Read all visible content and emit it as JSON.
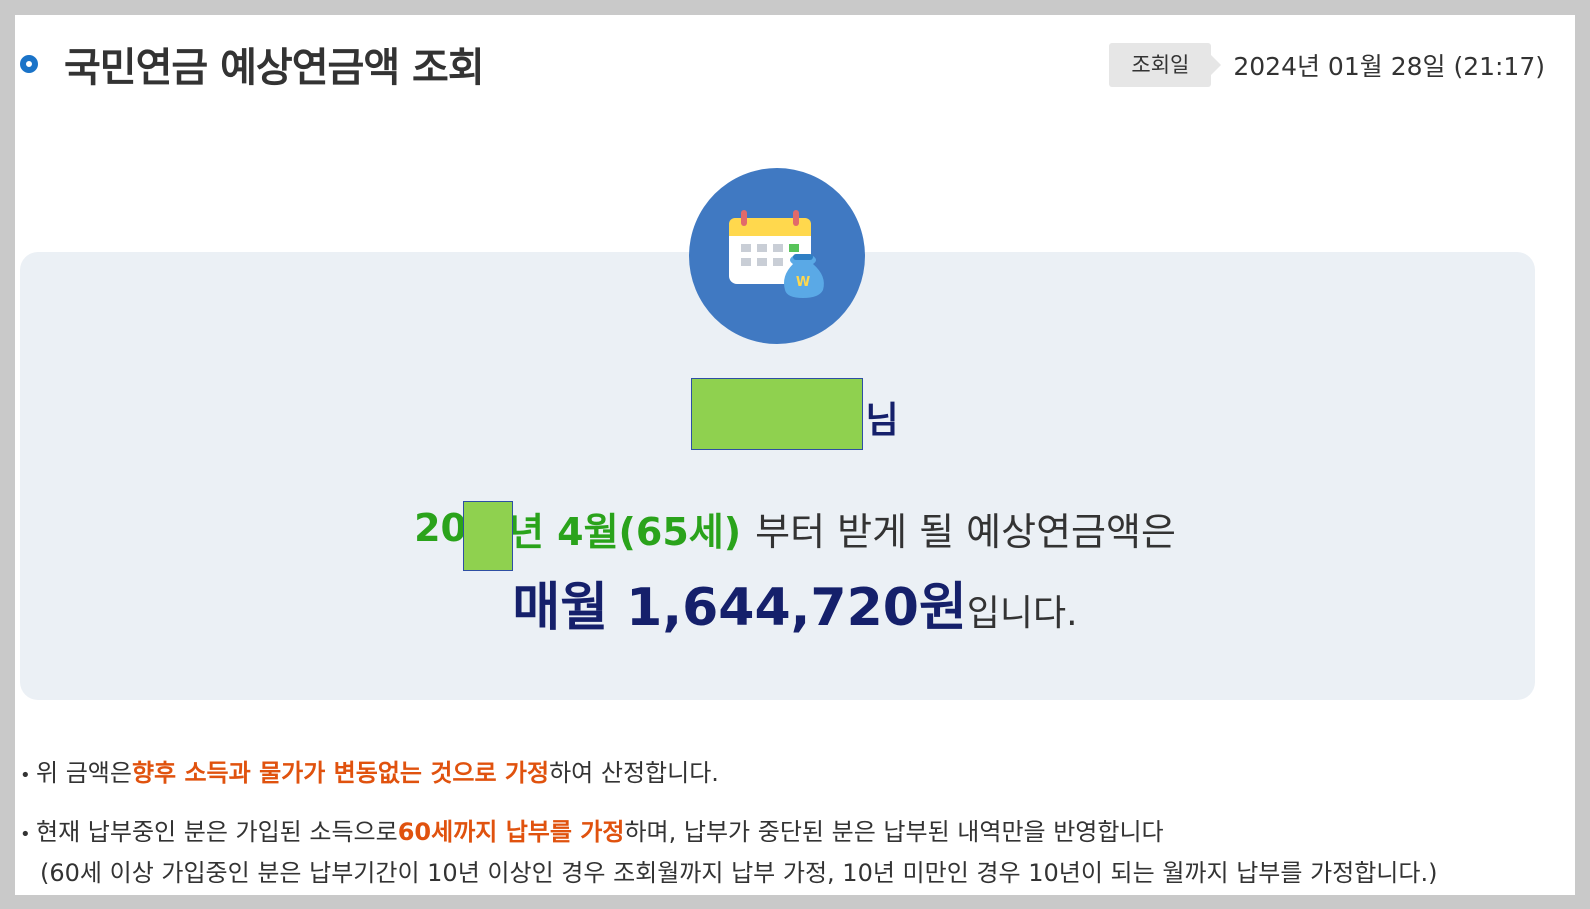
{
  "header": {
    "title": "국민연금 예상연금액 조회",
    "date_label": "조회일",
    "date_value": "2024년 01월 28일 (21:17)"
  },
  "result": {
    "name_suffix": "님",
    "start_prefix": "20",
    "start_suffix": "년 4월(65세)",
    "start_rest": " 부터 받게 될 예상연금액은",
    "amount_main": "매월 1,644,720원",
    "amount_tail": "입니다."
  },
  "notes": {
    "note1_before": "위 금액은 ",
    "note1_highlight": "향후 소득과 물가가 변동없는 것으로 가정",
    "note1_after": "하여 산정합니다.",
    "note2_before": "현재 납부중인 분은 가입된 소득으로 ",
    "note2_highlight": "60세까지 납부를 가정",
    "note2_after": "하며, 납부가 중단된 분은 납부된 내역만을 반영합니다",
    "note2_sub": "(60세 이상 가입중인 분은 납부기간이 10년 이상인 경우 조회월까지 납부 가정, 10년 미만인 경우 10년이 되는 월까지 납부를 가정합니다.)"
  },
  "colors": {
    "accent_blue": "#1a73c8",
    "icon_circle": "#4079c2",
    "navy": "#15206b",
    "green": "#2aa31b",
    "orange": "#e0520e",
    "box_bg": "#ebf0f5",
    "mask": "#8fd14f"
  },
  "icons": {
    "title_marker": "circle-bullet-icon",
    "main": "calendar-money-bag-icon"
  }
}
